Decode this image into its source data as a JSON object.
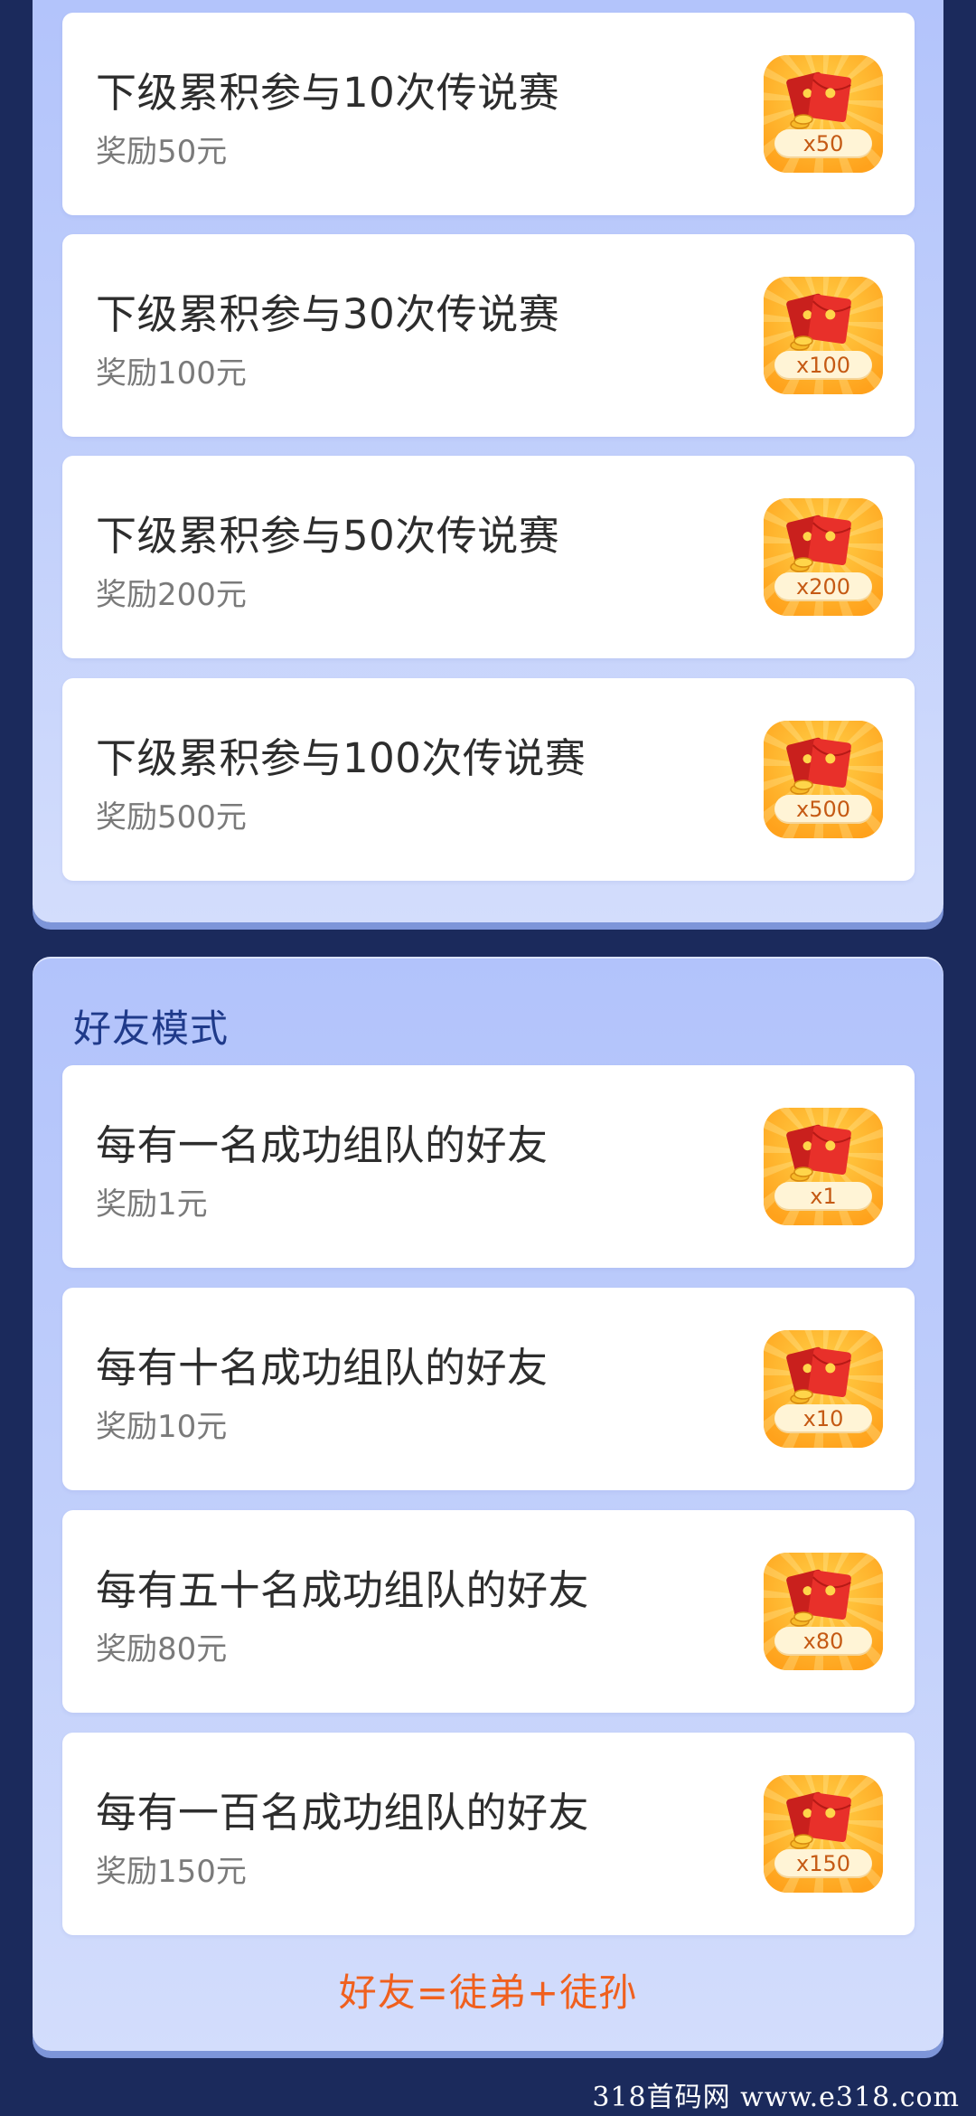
{
  "battle_panel": {
    "items": [
      {
        "title": "下级累积参与10次传说赛",
        "reward": "奖励50元",
        "count": "x50"
      },
      {
        "title": "下级累积参与30次传说赛",
        "reward": "奖励100元",
        "count": "x100"
      },
      {
        "title": "下级累积参与50次传说赛",
        "reward": "奖励200元",
        "count": "x200"
      },
      {
        "title": "下级累积参与100次传说赛",
        "reward": "奖励500元",
        "count": "x500"
      }
    ]
  },
  "friend_panel": {
    "title": "好友模式",
    "items": [
      {
        "title": "每有一名成功组队的好友",
        "reward": "奖励1元",
        "count": "x1"
      },
      {
        "title": "每有十名成功组队的好友",
        "reward": "奖励10元",
        "count": "x10"
      },
      {
        "title": "每有五十名成功组队的好友",
        "reward": "奖励80元",
        "count": "x80"
      },
      {
        "title": "每有一百名成功组队的好友",
        "reward": "奖励150元",
        "count": "x150"
      }
    ],
    "formula": "好友=徒弟+徒孙"
  },
  "watermark": "318首码网  www.e318.com",
  "colors": {
    "page_background": "#1b2a5c",
    "panel_top": "#b2c3fb",
    "panel_bottom": "#d3ddfc",
    "badge_orange": "#ffa21c",
    "red_packet": "#e8302a",
    "formula_text": "#f0601e",
    "section_title": "#1f3a8a"
  },
  "icons": {
    "reward_badge": "red-envelope-reward-icon"
  }
}
